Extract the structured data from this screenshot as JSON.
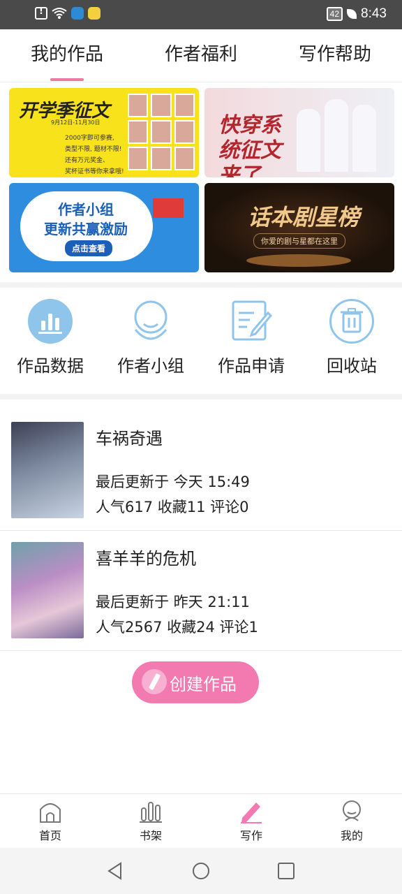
{
  "status_bar": {
    "time": "8:43",
    "battery": "42"
  },
  "tabs": [
    {
      "label": "我的作品",
      "active": true
    },
    {
      "label": "作者福利",
      "active": false
    },
    {
      "label": "写作帮助",
      "active": false
    }
  ],
  "banners": [
    {
      "title": "开学季征文",
      "date": "9月12日-11月30日",
      "text": "2000字即可参赛,\n类型不限, 题材不限!\n还有万元奖金、\n奖杯证书等你来拿哦!"
    },
    {
      "title": "快穿系统征文来了"
    },
    {
      "title": "作者小组\n更新共赢激励",
      "cta": "点击查看"
    },
    {
      "title": "话本剧星榜",
      "sub": "你爱的剧与星都在这里"
    }
  ],
  "shortcuts": [
    {
      "label": "作品数据",
      "icon": "bar-chart-icon"
    },
    {
      "label": "作者小组",
      "icon": "group-icon"
    },
    {
      "label": "作品申请",
      "icon": "edit-document-icon"
    },
    {
      "label": "回收站",
      "icon": "trash-icon"
    }
  ],
  "works": [
    {
      "title": "车祸奇遇",
      "updated": "最后更新于 今天 15:49",
      "stats": "人气617 收藏11 评论0"
    },
    {
      "title": "喜羊羊的危机",
      "updated": "最后更新于 昨天 21:11",
      "stats": "人气2567 收藏24 评论1"
    }
  ],
  "create_button": {
    "label": "创建作品"
  },
  "bottom_nav": [
    {
      "label": "首页",
      "icon": "home-icon",
      "active": false
    },
    {
      "label": "书架",
      "icon": "bookshelf-icon",
      "active": false
    },
    {
      "label": "写作",
      "icon": "pencil-icon",
      "active": true
    },
    {
      "label": "我的",
      "icon": "profile-icon",
      "active": false
    }
  ],
  "colors": {
    "accent": "#f27ab0",
    "icon_blue": "#8fc5ea",
    "status_bar": "#4a4a4a"
  }
}
